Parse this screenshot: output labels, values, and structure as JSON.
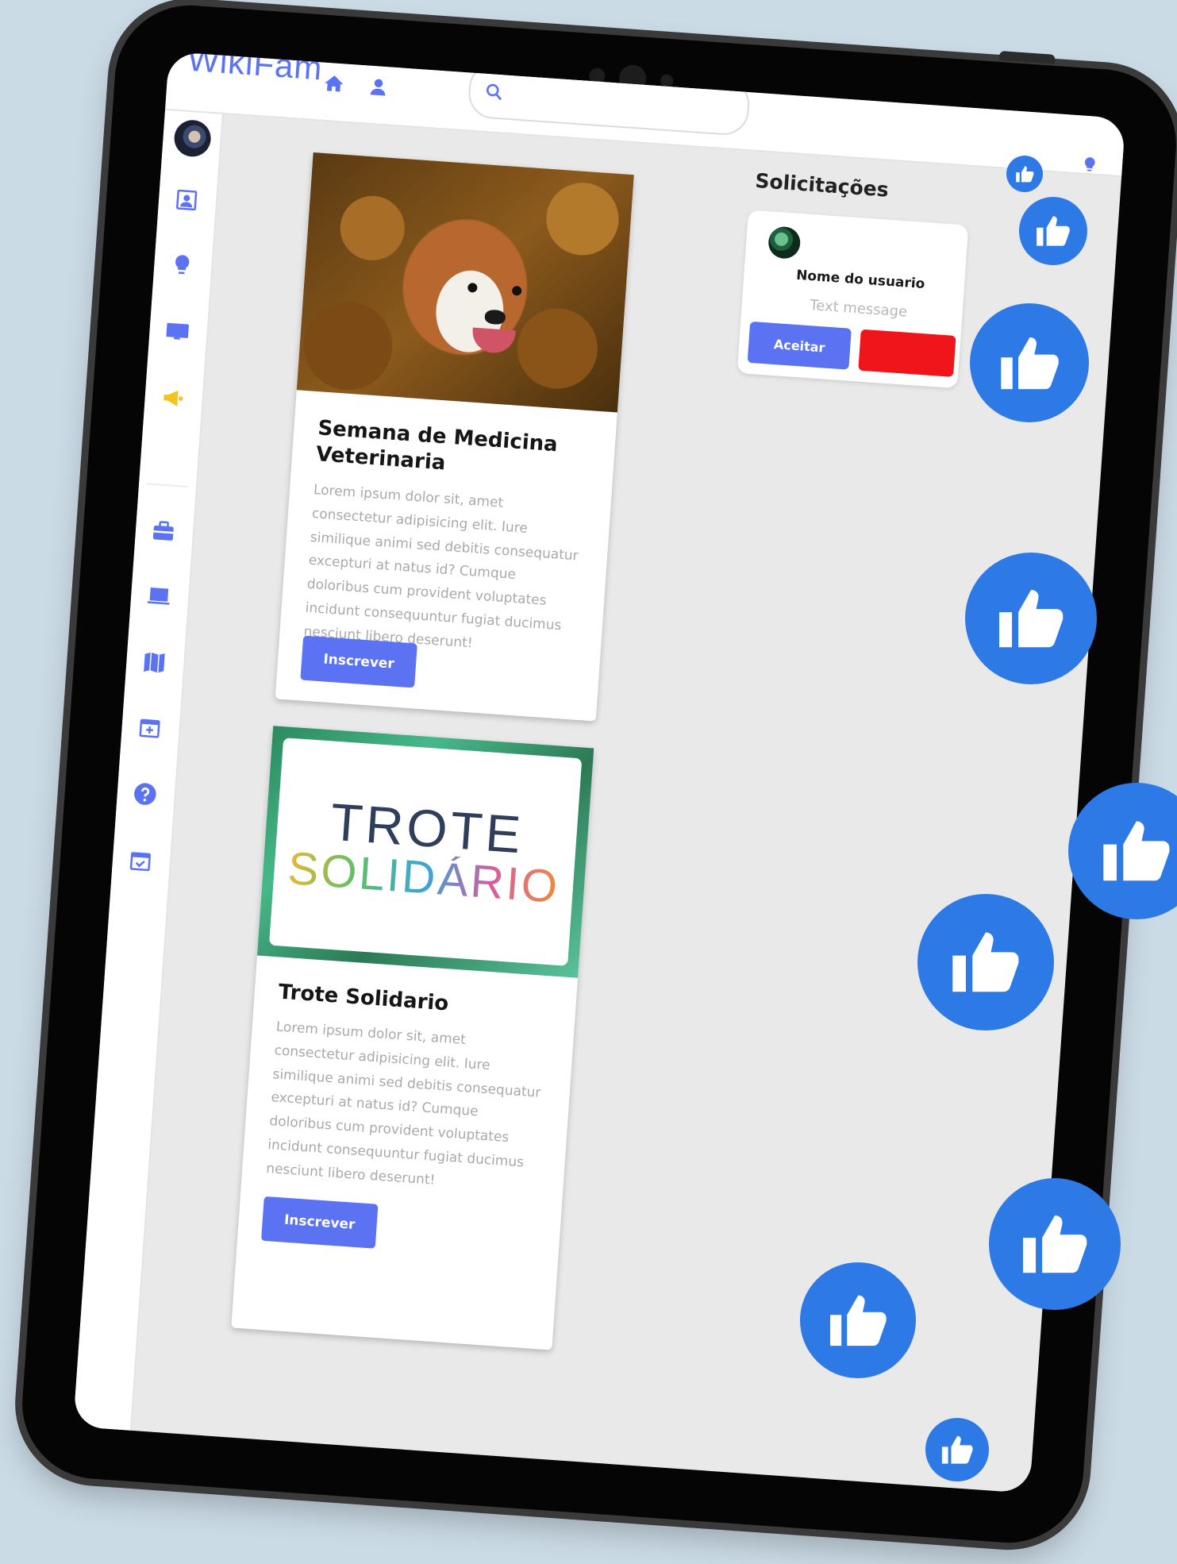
{
  "app": {
    "brand": "WikiFam"
  },
  "search": {
    "placeholder": ""
  },
  "feed": {
    "cards": [
      {
        "title": "Semana de Medicina Veterinaria",
        "text": "Lorem ipsum dolor sit, amet consectetur adipisicing elit. Iure similique animi sed debitis consequatur excepturi at natus id? Cumque doloribus cum provident voluptates incidunt consequuntur fugiat ducimus nesciunt libero deserunt!",
        "button": "Inscrever"
      },
      {
        "title": "Trote Solidario",
        "text": "Lorem ipsum dolor sit, amet consectetur adipisicing elit. Iure similique animi sed debitis consequatur excepturi at natus id? Cumque doloribus cum provident voluptates incidunt consequuntur fugiat ducimus nesciunt libero deserunt!",
        "button": "Inscrever",
        "image_text_line1": "TROTE",
        "image_text_line2": "SOLIDÁRIO"
      }
    ]
  },
  "requests": {
    "title": "Solicitações",
    "items": [
      {
        "name": "Nome do usuario",
        "message": "Text message",
        "accept_label": "Aceitar",
        "decline_label": ""
      }
    ]
  },
  "icons": {
    "top": [
      "home-icon",
      "user-icon",
      "search-icon"
    ],
    "sidebar": [
      "profile-card-icon",
      "lightbulb-icon",
      "monitor-icon",
      "megaphone-icon",
      "briefcase-icon",
      "laptop-icon",
      "map-icon",
      "calendar-add-icon",
      "help-icon",
      "calendar-check-icon"
    ],
    "like": "thumbs-up-icon"
  },
  "colors": {
    "accent": "#5b73f3",
    "decline": "#f0141b",
    "like": "#2d79e6",
    "megaphone": "#f3c31e",
    "background": "#cbdbe6"
  }
}
